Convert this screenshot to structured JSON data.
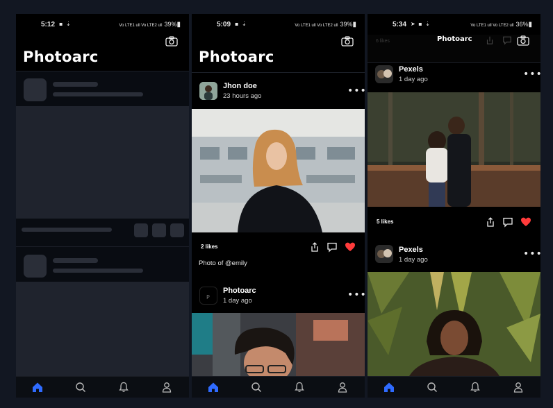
{
  "screens": [
    {
      "status": {
        "time": "5:12",
        "battery": "39%"
      },
      "app_title": "Photoarc",
      "state": "loading"
    },
    {
      "status": {
        "time": "5:09",
        "battery": "39%"
      },
      "app_title": "Photoarc",
      "posts": [
        {
          "author": "Jhon doe",
          "time": "23 hours ago",
          "likes": "2 likes",
          "caption": "Photo of @emily"
        },
        {
          "author": "Photoarc",
          "time": "1 day ago"
        }
      ]
    },
    {
      "status": {
        "time": "5:34",
        "battery": "36%"
      },
      "app_title": "Photoarc",
      "ghost_likes": "6 likes",
      "posts": [
        {
          "author": "Pexels",
          "time": "1 day ago",
          "likes": "5 likes"
        },
        {
          "author": "Pexels",
          "time": "1 day ago"
        }
      ]
    }
  ],
  "nav_items": [
    "home-icon",
    "search-icon",
    "bell-icon",
    "user-icon"
  ],
  "colors": {
    "accent": "#2f6bff",
    "like": "#ff3b3b",
    "background": "#000000",
    "frame": "#121722"
  },
  "status_signal": "Vo LTE1 ull Vo LTE2 ull"
}
